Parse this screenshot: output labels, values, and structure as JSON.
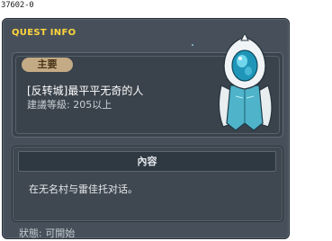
{
  "quest_id": "37602-0",
  "window": {
    "title": "QUEST INFO"
  },
  "summary": {
    "type_badge": "主要",
    "quest_name": "[反转城]最平平无奇的人",
    "recommended_level": "建議等級: 205以上"
  },
  "content": {
    "header": "內容",
    "text": "在无名村与雷佳托对话。"
  },
  "status": "狀態: 可開始",
  "colors": {
    "title": "#ffd53d",
    "badge_bg": "#c4ab86",
    "panel_bg": "#47505a"
  },
  "icons": {
    "npc": "hooded-npc-icon"
  }
}
